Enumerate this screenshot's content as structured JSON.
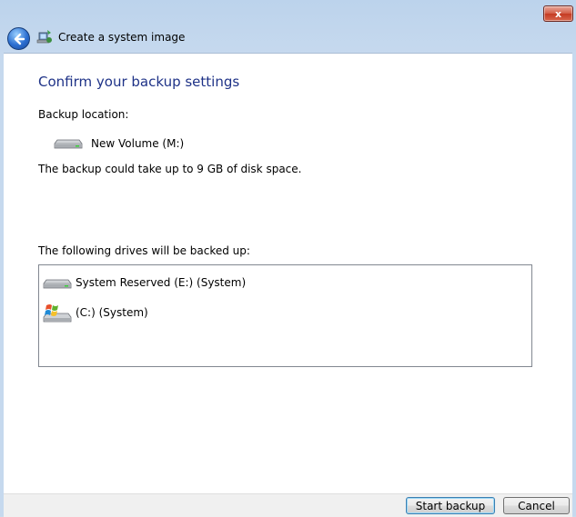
{
  "window": {
    "title": "Create a system image",
    "close_glyph": "x"
  },
  "page": {
    "heading": "Confirm your backup settings",
    "backup_location_label": "Backup location:",
    "backup_location_value": "New Volume (M:)",
    "space_note": "The backup could take up to 9 GB of disk space.",
    "drives_label": "The following drives will be backed up:",
    "drives": [
      {
        "name": "System Reserved (E:) (System)",
        "icon": "hard-drive-icon"
      },
      {
        "name": "(C:) (System)",
        "icon": "windows-drive-icon"
      }
    ]
  },
  "footer": {
    "start_label": "Start backup",
    "cancel_label": "Cancel"
  },
  "colors": {
    "heading": "#1e3287",
    "frame": "#c6d9ee",
    "close_red": "#c43b23"
  }
}
